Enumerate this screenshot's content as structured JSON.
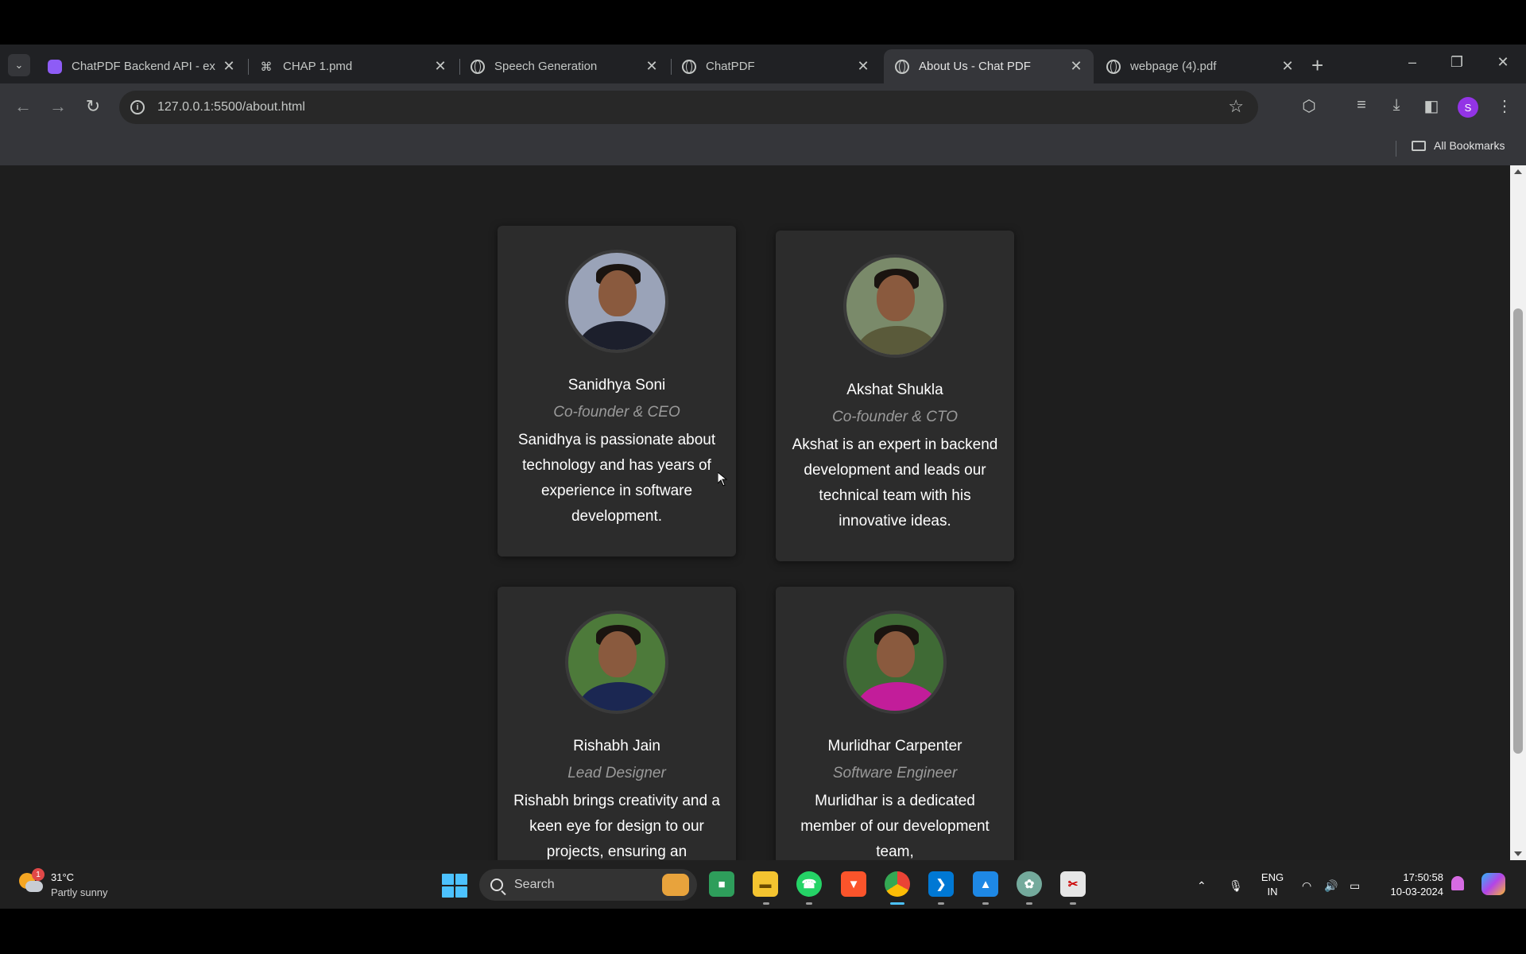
{
  "browser": {
    "tabs": [
      {
        "title": "ChatPDF Backend API - ex",
        "favicon": "purple-app-icon",
        "active": false
      },
      {
        "title": "CHAP 1.pmd",
        "favicon": "document-icon",
        "active": false
      },
      {
        "title": "Speech Generation",
        "favicon": "globe-icon",
        "active": false
      },
      {
        "title": "ChatPDF",
        "favicon": "globe-icon",
        "active": false
      },
      {
        "title": "About Us - Chat PDF",
        "favicon": "globe-icon",
        "active": true
      },
      {
        "title": "webpage (4).pdf",
        "favicon": "globe-icon",
        "active": false
      }
    ],
    "url": "127.0.0.1:5500/about.html",
    "profile_initial": "S",
    "bookmarks_label": "All Bookmarks"
  },
  "team": [
    {
      "name": "Sanidhya Soni",
      "role": "Co-founder & CEO",
      "bio": "Sanidhya is passionate about technology and has years of experience in software development.",
      "shirt_color": "#1c1f2c"
    },
    {
      "name": "Akshat Shukla",
      "role": "Co-founder & CTO",
      "bio": "Akshat is an expert in backend development and leads our technical team with his innovative ideas.",
      "shirt_color": "#5a5a3a"
    },
    {
      "name": "Rishabh Jain",
      "role": "Lead Designer",
      "bio": "Rishabh brings creativity and a keen eye for design to our projects, ensuring an",
      "shirt_color": "#1b2752"
    },
    {
      "name": "Murlidhar Carpenter",
      "role": "Software Engineer",
      "bio": "Murlidhar is a dedicated member of our development team,",
      "shirt_color": "#c21d9a"
    }
  ],
  "taskbar": {
    "weather_temp": "31°C",
    "weather_desc": "Partly sunny",
    "weather_badge": "1",
    "search_label": "Search",
    "lang_top": "ENG",
    "lang_bottom": "IN",
    "time": "17:50:58",
    "date": "10-03-2024"
  }
}
